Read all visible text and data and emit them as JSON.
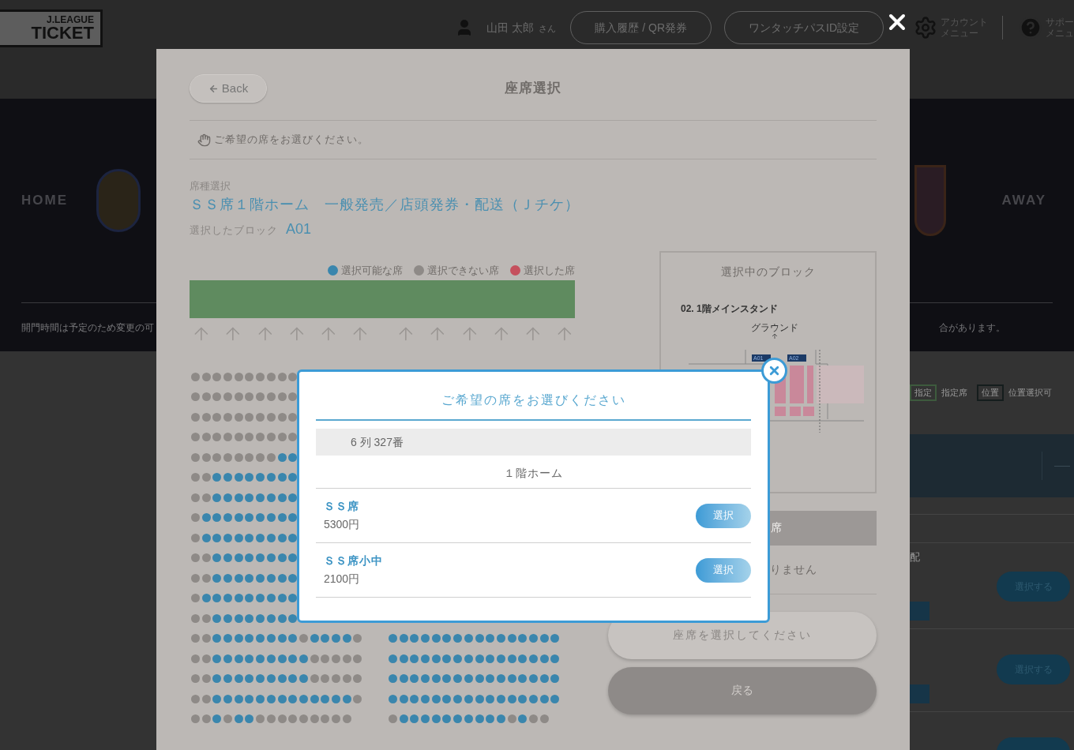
{
  "header": {
    "logo": [
      "J.LEAGUE",
      "TICKET"
    ],
    "user": "山田 太郎",
    "user_suffix": "さん",
    "buttons": [
      "購入履歴 / QR発券",
      "ワンタッチパスID設定"
    ],
    "menus": [
      {
        "kind": "gear",
        "lines": [
          "アカウント",
          "メニュー"
        ]
      },
      {
        "kind": "help",
        "lines": [
          "サポー",
          "メニュ"
        ]
      }
    ]
  },
  "match": {
    "home": "HOME",
    "away": "AWAY",
    "notice_left": "開門時間は予定のため変更の可",
    "notice_right": "合があります。"
  },
  "legend_bg": [
    {
      "badge": "指定",
      "label": "指定席",
      "color": "#3d5a3d"
    },
    {
      "badge": "位置",
      "label": "位置選択可",
      "color": "#151d1d"
    }
  ],
  "bg_list": {
    "partial_text": "配",
    "buttons": [
      "選択する",
      "選択する"
    ]
  },
  "panel": {
    "back": "Back",
    "title": "座席選択",
    "hint": "ご希望の席をお選びください。",
    "seat_type_label": "席種選択",
    "seat_type": "ＳＳ席１階ホーム　一般発売／店頭発券・配送（Ｊチケ）",
    "block_label": "選択したブロック",
    "block": "A01",
    "legend": [
      {
        "label": "選択可能な席",
        "color": "#3a86ad"
      },
      {
        "label": "選択できない席",
        "color": "#8e8a87"
      },
      {
        "label": "選択した席",
        "color": "#c5505d"
      }
    ],
    "seat_rows": [
      {
        "left": [
          false,
          false,
          false,
          false,
          false,
          false,
          false,
          false,
          false,
          false
        ]
      },
      {
        "left": [
          false,
          false,
          false,
          false,
          false,
          false,
          false,
          false,
          false,
          false
        ]
      },
      {
        "left": [
          false,
          false,
          false,
          false,
          false,
          false,
          false,
          false,
          false,
          false
        ]
      },
      {
        "left": [
          false,
          false,
          false,
          false,
          false,
          false,
          false,
          false,
          false,
          false
        ]
      },
      {
        "left": [
          false,
          false,
          false,
          false,
          false,
          false,
          false,
          false,
          true,
          true
        ]
      },
      {
        "left": [
          false,
          false,
          true,
          true,
          true,
          true,
          true,
          true,
          true,
          true
        ]
      },
      {
        "left": [
          false,
          false,
          true,
          true,
          true,
          true,
          true,
          true,
          true,
          true
        ]
      },
      {
        "left": [
          false,
          true,
          true,
          true,
          true,
          true,
          true,
          true,
          true,
          true
        ]
      },
      {
        "left": [
          false,
          true,
          true,
          true,
          true,
          true,
          true,
          true,
          true,
          true
        ]
      },
      {
        "left": [
          false,
          false,
          true,
          true,
          true,
          true,
          true,
          true,
          true,
          true
        ]
      },
      {
        "left": [
          false,
          false,
          true,
          true,
          true,
          true,
          true,
          true,
          true,
          true
        ]
      },
      {
        "left": [
          false,
          true,
          true,
          true,
          true,
          true,
          true,
          true,
          true,
          true
        ]
      },
      {
        "left": [
          false,
          false,
          true,
          true,
          true,
          true,
          true,
          true,
          true,
          true
        ]
      },
      {
        "left": [
          false,
          false,
          true,
          true,
          true,
          true,
          true,
          true,
          true,
          true,
          false,
          true,
          true,
          true,
          true,
          false
        ],
        "right": [
          true,
          true,
          true,
          true,
          true,
          true,
          true,
          true,
          true,
          true,
          true,
          true,
          true,
          true,
          true,
          true
        ]
      },
      {
        "left": [
          false,
          false,
          true,
          true,
          true,
          true,
          true,
          true,
          true,
          true,
          true,
          false,
          false,
          false,
          false,
          false
        ],
        "right": [
          true,
          true,
          true,
          true,
          true,
          true,
          true,
          true,
          true,
          true,
          true,
          true,
          true,
          true,
          true,
          true
        ]
      },
      {
        "left": [
          false,
          false,
          true,
          true,
          true,
          true,
          true,
          true,
          true,
          true,
          true,
          false,
          false,
          false,
          false,
          false
        ],
        "right": [
          true,
          true,
          true,
          true,
          true,
          true,
          true,
          true,
          true,
          true,
          true,
          true,
          true,
          true,
          true,
          true
        ]
      },
      {
        "left": [
          false,
          false,
          true,
          true,
          true,
          true,
          true,
          true,
          true,
          true,
          true,
          true,
          true,
          true,
          true,
          false
        ],
        "right": [
          true,
          true,
          true,
          true,
          true,
          true,
          true,
          true,
          true,
          true,
          true,
          true,
          true,
          true,
          true,
          true
        ]
      },
      {
        "left": [
          false,
          false,
          true,
          false,
          true,
          true,
          false,
          false,
          false,
          false,
          false,
          false,
          false,
          false,
          false
        ],
        "right": [
          false,
          true,
          true,
          true,
          true,
          true,
          true,
          true,
          true,
          true,
          true,
          false,
          true,
          false,
          false
        ]
      }
    ],
    "map": {
      "title": "選択中のブロック",
      "stand": "02. 1階メインスタンド",
      "ground": "グラウンド",
      "blocks": [
        "A01",
        "A02"
      ]
    },
    "cut_bar_text": "席",
    "cut_note": "りません",
    "submit": {
      "label": "座席を選択してください",
      "disabled": true
    },
    "return": "戻る"
  },
  "dialog": {
    "title": "ご希望の席をお選びください",
    "seat": "6 列 327番",
    "area": "１階ホーム",
    "options": [
      {
        "name": "ＳＳ席",
        "price": "5300円",
        "button": "選択"
      },
      {
        "name": "ＳＳ席小中",
        "price": "2100円",
        "button": "選択"
      }
    ]
  }
}
